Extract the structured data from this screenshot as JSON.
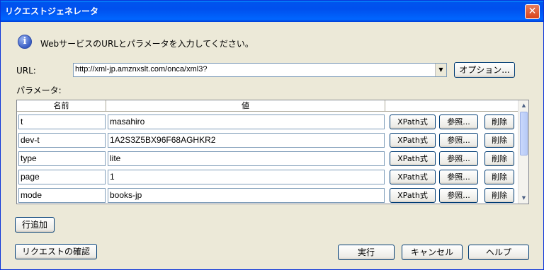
{
  "window": {
    "title": "リクエストジェネレータ",
    "close_glyph": "✕"
  },
  "info": {
    "icon": "info-icon",
    "glyph": "i",
    "text": "WebサービスのURLとパラメータを入力してください。"
  },
  "url": {
    "label": "URL:",
    "value": "http://xml-jp.amznxslt.com/onca/xml3?",
    "dropdown_glyph": "▼",
    "options_button": "オプション..."
  },
  "params": {
    "label": "パラメータ:",
    "headers": {
      "name": "名前",
      "value": "値"
    },
    "rows": [
      {
        "name": "t",
        "value": "masahiro"
      },
      {
        "name": "dev-t",
        "value": "1A2S3Z5BX96F68AGHKR2"
      },
      {
        "name": "type",
        "value": "lite"
      },
      {
        "name": "page",
        "value": "1"
      },
      {
        "name": "mode",
        "value": "books-jp"
      }
    ],
    "row_buttons": {
      "xpath": "XPath式",
      "browse": "参照...",
      "delete": "削除"
    },
    "scroll_up": "▲",
    "scroll_down": "▼"
  },
  "buttons": {
    "add_row": "行追加",
    "confirm_request": "リクエストの確認",
    "execute": "実行",
    "cancel": "キャンセル",
    "help": "ヘルプ"
  }
}
